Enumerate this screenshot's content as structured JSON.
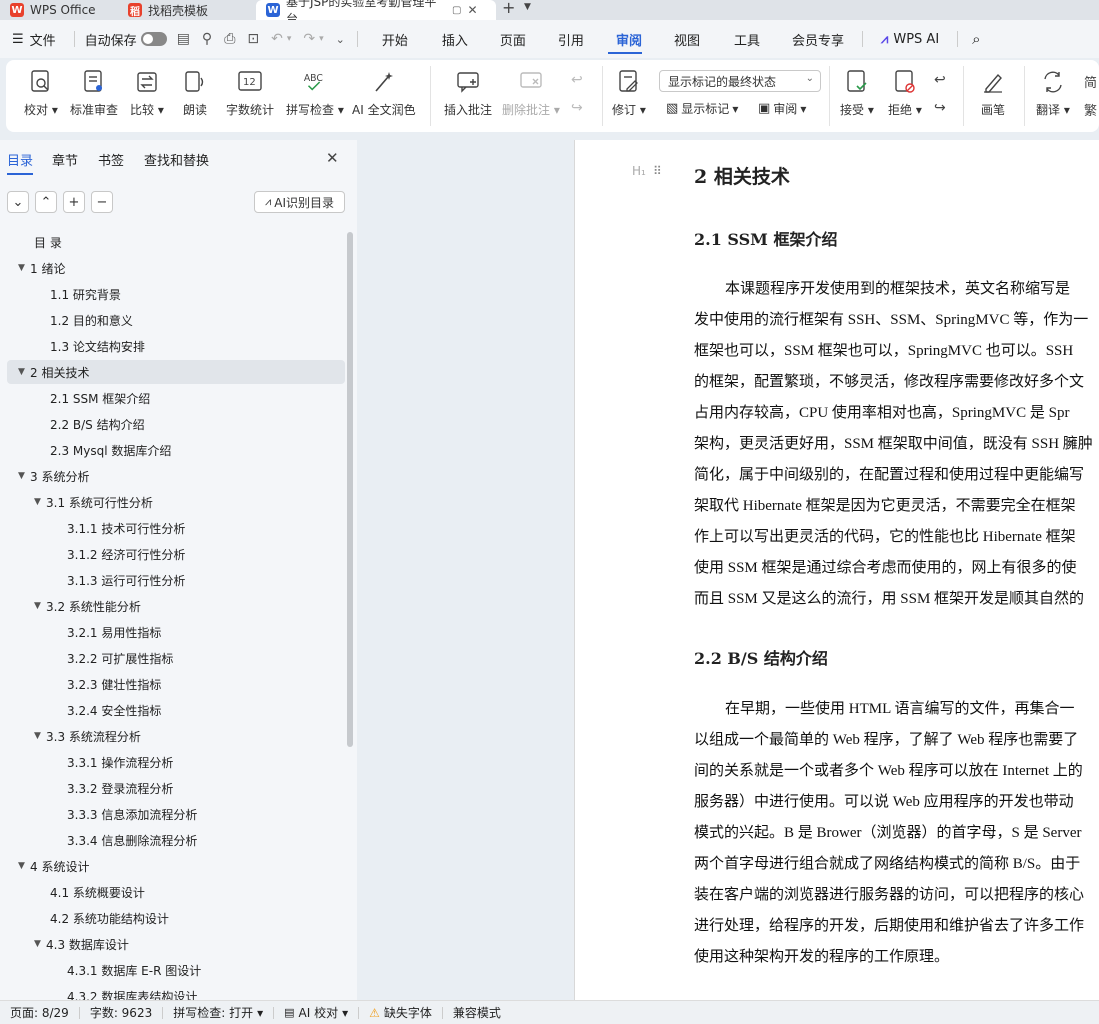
{
  "tabs": {
    "wps": "WPS Office",
    "template": "找稻壳模板",
    "doc": "基于JSP的实验室考勤管理平台"
  },
  "menu": {
    "file": "文件",
    "autosave": "自动保存",
    "items": [
      "开始",
      "插入",
      "页面",
      "引用",
      "审阅",
      "视图",
      "工具",
      "会员专享"
    ],
    "active": "审阅",
    "wps_ai": "WPS AI"
  },
  "ribbon": {
    "proofread": "校对",
    "standard_review": "标准审查",
    "compare": "比较",
    "read_aloud": "朗读",
    "word_count": "字数统计",
    "spell_check": "拼写检查",
    "ai_polish": "AI 全文润色",
    "insert_comment": "插入批注",
    "delete_comment": "删除批注",
    "track_changes": "修订",
    "markup_mode": "显示标记的最终状态",
    "show_markup": "显示标记",
    "review": "审阅",
    "accept": "接受",
    "reject": "拒绝",
    "pen": "画笔",
    "translate": "翻译",
    "simplified": "简",
    "traditional": "繁"
  },
  "sidebar": {
    "tabs": [
      "目录",
      "章节",
      "书签",
      "查找和替换"
    ],
    "active_tab": "目录",
    "ai_button": "AI识别目录",
    "toc": [
      {
        "label": "目 录",
        "level": 0,
        "caret": ""
      },
      {
        "label": "1  绪论",
        "level": 0,
        "caret": "▼"
      },
      {
        "label": "1.1  研究背景",
        "level": 1,
        "caret": ""
      },
      {
        "label": "1.2  目的和意义",
        "level": 1,
        "caret": ""
      },
      {
        "label": "1.3  论文结构安排",
        "level": 1,
        "caret": ""
      },
      {
        "label": "2  相关技术",
        "level": 0,
        "caret": "▼",
        "selected": true
      },
      {
        "label": "2.1 SSM 框架介绍",
        "level": 1,
        "caret": ""
      },
      {
        "label": "2.2 B/S 结构介绍",
        "level": 1,
        "caret": ""
      },
      {
        "label": "2.3 Mysql 数据库介绍",
        "level": 1,
        "caret": ""
      },
      {
        "label": "3  系统分析",
        "level": 0,
        "caret": "▼"
      },
      {
        "label": "3.1  系统可行性分析",
        "level": 1,
        "caret": "▼"
      },
      {
        "label": "3.1.1  技术可行性分析",
        "level": 2,
        "caret": ""
      },
      {
        "label": "3.1.2  经济可行性分析",
        "level": 2,
        "caret": ""
      },
      {
        "label": "3.1.3  运行可行性分析",
        "level": 2,
        "caret": ""
      },
      {
        "label": "3.2  系统性能分析",
        "level": 1,
        "caret": "▼"
      },
      {
        "label": "3.2.1  易用性指标",
        "level": 2,
        "caret": ""
      },
      {
        "label": "3.2.2  可扩展性指标",
        "level": 2,
        "caret": ""
      },
      {
        "label": "3.2.3  健壮性指标",
        "level": 2,
        "caret": ""
      },
      {
        "label": "3.2.4  安全性指标",
        "level": 2,
        "caret": ""
      },
      {
        "label": "3.3  系统流程分析",
        "level": 1,
        "caret": "▼"
      },
      {
        "label": "3.3.1  操作流程分析",
        "level": 2,
        "caret": ""
      },
      {
        "label": "3.3.2  登录流程分析",
        "level": 2,
        "caret": ""
      },
      {
        "label": "3.3.3  信息添加流程分析",
        "level": 2,
        "caret": ""
      },
      {
        "label": "3.3.4  信息删除流程分析",
        "level": 2,
        "caret": ""
      },
      {
        "label": "4  系统设计",
        "level": 0,
        "caret": "▼"
      },
      {
        "label": "4.1  系统概要设计",
        "level": 1,
        "caret": ""
      },
      {
        "label": "4.2  系统功能结构设计",
        "level": 1,
        "caret": ""
      },
      {
        "label": "4.3  数据库设计",
        "level": 1,
        "caret": "▼"
      },
      {
        "label": "4.3.1  数据库 E-R 图设计",
        "level": 2,
        "caret": ""
      },
      {
        "label": "4.3.2  数据库表结构设计",
        "level": 2,
        "caret": ""
      }
    ]
  },
  "document": {
    "heading_marker": "H₁",
    "h1": "2  相关技术",
    "h2_1": "2.1 SSM 框架介绍",
    "p1": [
      "本课题程序开发使用到的框架技术，英文名称缩写是",
      "发中使用的流行框架有 SSH、SSM、SpringMVC 等，作为一",
      "框架也可以，SSM 框架也可以，SpringMVC 也可以。SSH",
      "的框架，配置繁琐，不够灵活，修改程序需要修改好多个文",
      "占用内存较高，CPU 使用率相对也高，SpringMVC 是 Spr",
      "架构，更灵活更好用，SSM 框架取中间值，既没有 SSH 臃肿",
      "简化，属于中间级别的，在配置过程和使用过程中更能编写",
      "架取代 Hibernate 框架是因为它更灵活，不需要完全在框架",
      "作上可以写出更灵活的代码，它的性能也比 Hibernate 框架",
      "使用 SSM 框架是通过综合考虑而使用的，网上有很多的使",
      "而且 SSM 又是这么的流行，用 SSM 框架开发是顺其自然的"
    ],
    "h2_2": "2.2 B/S 结构介绍",
    "p2": [
      "在早期，一些使用 HTML 语言编写的文件，再集合一",
      "以组成一个最简单的 Web 程序，了解了 Web 程序也需要了",
      "间的关系就是一个或者多个 Web 程序可以放在 Internet 上的",
      "服务器）中进行使用。可以说 Web 应用程序的开发也带动",
      "模式的兴起。B 是 Brower（浏览器）的首字母，S 是 Server",
      "两个首字母进行组合就成了网络结构模式的简称 B/S。由于",
      "装在客户端的浏览器进行服务器的访问，可以把程序的核心",
      "进行处理，给程序的开发，后期使用和维护省去了许多工作",
      "使用这种架构开发的程序的工作原理。"
    ]
  },
  "status": {
    "page": "页面: 8/29",
    "words": "字数: 9623",
    "spell": "拼写检查: 打开",
    "ai_check": "AI 校对",
    "missing_font": "缺失字体",
    "compat": "兼容模式"
  },
  "colors": {
    "accent": "#2b64d6",
    "wps_red": "#e8412c",
    "warn": "#f0a020"
  }
}
